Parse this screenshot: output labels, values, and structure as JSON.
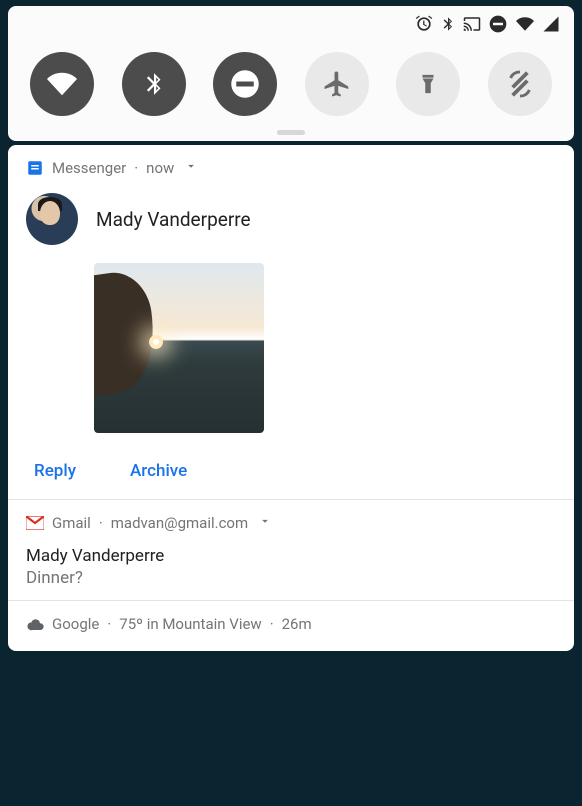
{
  "status_bar": {
    "icons": [
      "alarm",
      "bluetooth",
      "cast",
      "dnd",
      "wifi",
      "signal"
    ]
  },
  "quick_settings": {
    "toggles": [
      {
        "name": "wifi",
        "on": true
      },
      {
        "name": "bluetooth",
        "on": true
      },
      {
        "name": "dnd",
        "on": true
      },
      {
        "name": "airplane",
        "on": false
      },
      {
        "name": "flashlight",
        "on": false
      },
      {
        "name": "rotation",
        "on": false
      }
    ]
  },
  "notifications": {
    "messenger": {
      "app": "Messenger",
      "time": "now",
      "sender": "Mady Vanderperre",
      "actions": {
        "reply": "Reply",
        "archive": "Archive"
      }
    },
    "gmail": {
      "app": "Gmail",
      "account": "madvan@gmail.com",
      "sender": "Mady Vanderperre",
      "subject": "Dinner?"
    },
    "weather": {
      "app": "Google",
      "summary": "75º in Mountain View",
      "time": "26m"
    }
  }
}
